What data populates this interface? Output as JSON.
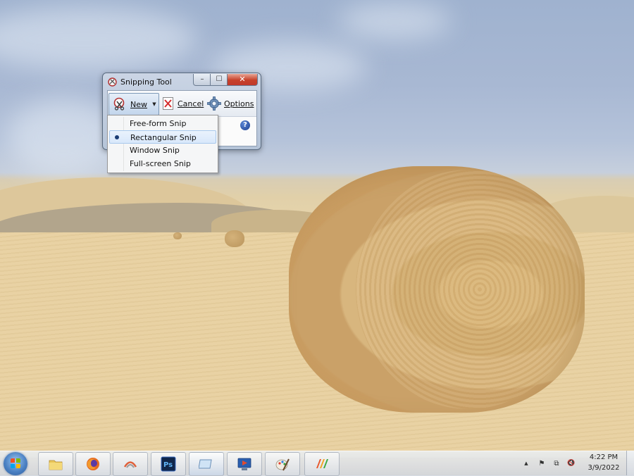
{
  "window": {
    "title": "Snipping Tool",
    "minimize_glyph": "–",
    "maximize_glyph": "☐",
    "close_glyph": "✕"
  },
  "toolbar": {
    "new_label": "New",
    "dropdown_glyph": "▼",
    "cancel_label": "Cancel",
    "options_label": "Options",
    "help_glyph": "?"
  },
  "snip_menu": {
    "items": [
      {
        "label": "Free-form Snip",
        "selected": false
      },
      {
        "label": "Rectangular Snip",
        "selected": true
      },
      {
        "label": "Window Snip",
        "selected": false
      },
      {
        "label": "Full-screen Snip",
        "selected": false
      }
    ]
  },
  "taskbar": {
    "apps": [
      {
        "name": "file-explorer",
        "icon": "folder-icon"
      },
      {
        "name": "firefox",
        "icon": "firefox-icon"
      },
      {
        "name": "recorder",
        "icon": "recorder-icon"
      },
      {
        "name": "photoshop",
        "icon": "photoshop-icon",
        "text": "Ps"
      },
      {
        "name": "snipping-tool",
        "icon": "snipping-tool-icon"
      },
      {
        "name": "media-player",
        "icon": "media-player-icon"
      },
      {
        "name": "paint",
        "icon": "paint-icon"
      },
      {
        "name": "office",
        "icon": "office-icon"
      }
    ],
    "tray": {
      "show_hidden_glyph": "▲",
      "flag_glyph": "⚑",
      "network_glyph": "⧉",
      "volume_glyph": "🔇"
    },
    "clock": {
      "time": "4:22 PM",
      "date": "3/9/2022"
    }
  },
  "colors": {
    "close_button": "#c7412a",
    "selection_highlight": "#d9e8fb",
    "selection_border": "#a8c8ec",
    "help_blue": "#1d3f8f"
  }
}
